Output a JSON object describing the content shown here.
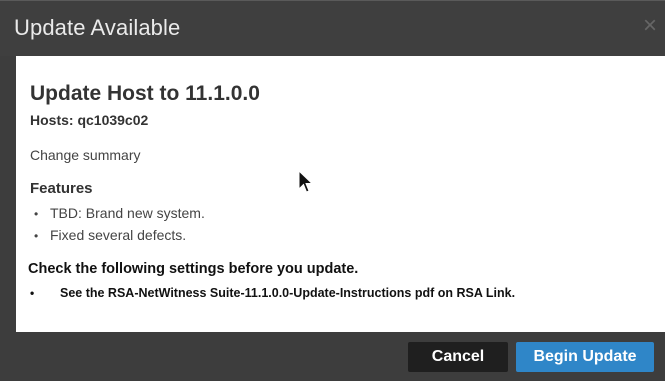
{
  "window": {
    "title": "Update Available",
    "close_symbol": "×"
  },
  "content": {
    "heading": "Update Host to 11.1.0.0",
    "hosts": "Hosts: qc1039c02",
    "summary": "Change summary",
    "features_title": "Features",
    "features": [
      "TBD: Brand new system.",
      "Fixed several defects."
    ],
    "check_title": "Check the following settings before you update.",
    "check_items": [
      "See the RSA-NetWitness Suite-11.1.0.0-Update-Instructions pdf on RSA Link."
    ]
  },
  "buttons": {
    "cancel": "Cancel",
    "begin_update": "Begin Update"
  },
  "colors": {
    "titlebar": "#3f3f3f",
    "primary_button": "#2f86c8",
    "secondary_button": "#1f1f1f"
  }
}
